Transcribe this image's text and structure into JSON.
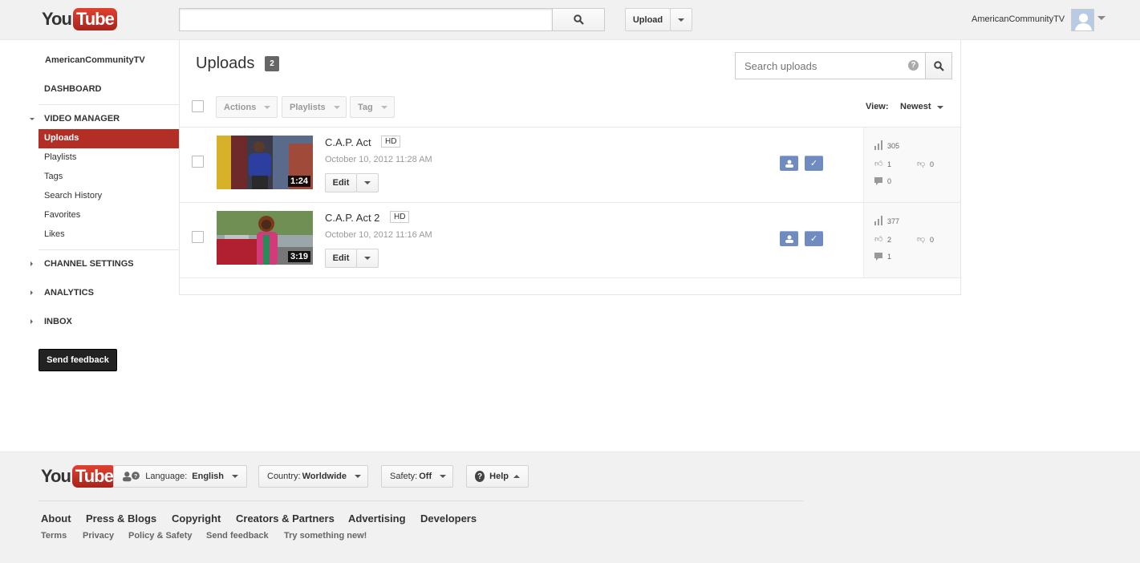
{
  "header": {
    "logo_you": "You",
    "logo_tube": "Tube",
    "search_placeholder": "",
    "upload_label": "Upload",
    "username": "AmericanCommunityTV"
  },
  "sidebar": {
    "channel_name": "AmericanCommunityTV",
    "dashboard": "DASHBOARD",
    "video_manager": "VIDEO MANAGER",
    "items": [
      "Uploads",
      "Playlists",
      "Tags",
      "Search History",
      "Favorites",
      "Likes"
    ],
    "channel_settings": "CHANNEL SETTINGS",
    "analytics": "ANALYTICS",
    "inbox": "INBOX",
    "send_feedback": "Send feedback"
  },
  "main": {
    "title": "Uploads",
    "count": "2",
    "search_placeholder": "Search uploads",
    "help_glyph": "?",
    "toolbar": {
      "actions": "Actions",
      "playlists": "Playlists",
      "tag": "Tag",
      "view_label": "View:",
      "view_value": "Newest"
    },
    "videos": [
      {
        "title": "C.A.P. Act",
        "hd": "HD",
        "date": "October 10, 2012 11:28 AM",
        "duration": "1:24",
        "edit": "Edit",
        "views": "305",
        "likes": "1",
        "dislikes": "0",
        "comments": "0"
      },
      {
        "title": "C.A.P. Act 2",
        "hd": "HD",
        "date": "October 10, 2012 11:16 AM",
        "duration": "3:19",
        "edit": "Edit",
        "views": "377",
        "likes": "2",
        "dislikes": "0",
        "comments": "1"
      }
    ]
  },
  "footer": {
    "logo_you": "You",
    "logo_tube": "Tube",
    "language_label": "Language:",
    "language_value": "English",
    "country_label": "Country:",
    "country_value": "Worldwide",
    "safety_label": "Safety:",
    "safety_value": "Off",
    "help": "Help",
    "links": [
      "About",
      "Press & Blogs",
      "Copyright",
      "Creators & Partners",
      "Advertising",
      "Developers"
    ],
    "sublinks": [
      "Terms",
      "Privacy",
      "Policy & Safety",
      "Send feedback",
      "Try something new!"
    ]
  },
  "colors": {
    "accent_red": "#b32f25",
    "status_blue": "#6f8bbf",
    "footer_bg": "#f1f1f1"
  }
}
